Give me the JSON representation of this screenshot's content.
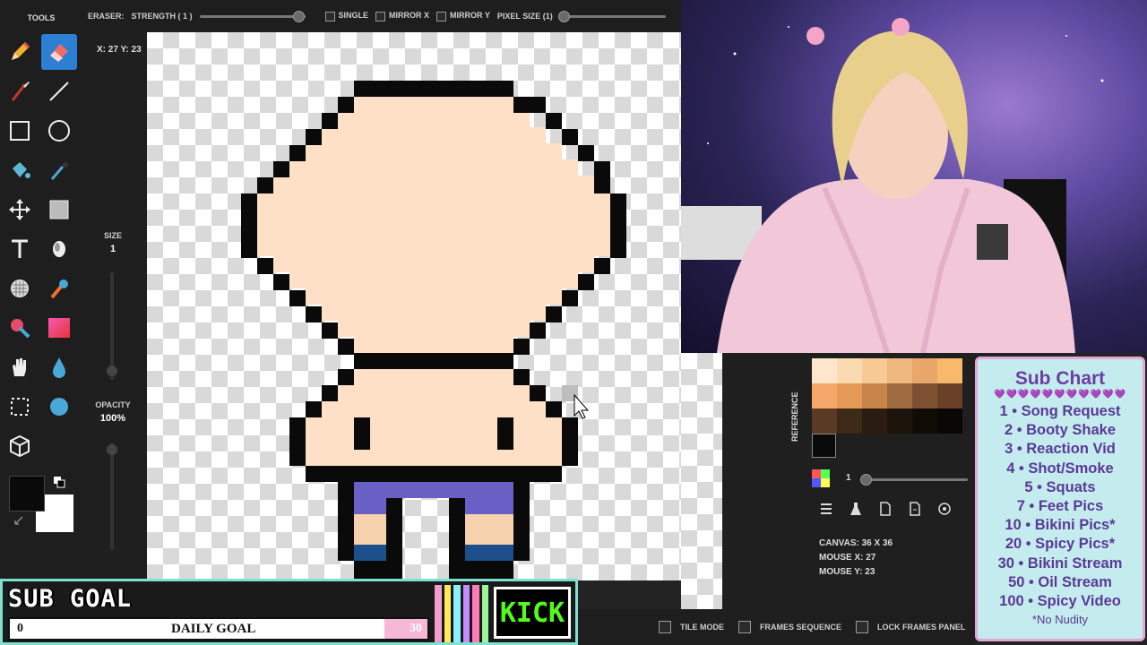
{
  "toolbar": {
    "tool_name": "ERASER:",
    "strength_label": "STRENGTH ( 1 )",
    "strength_fraction": 0.92,
    "single_label": "SINGLE",
    "mirror_x_label": "MIRROR X",
    "mirror_y_label": "MIRROR Y",
    "pixel_size_label": "PIXEL SIZE (1)",
    "pixel_size_fraction": 0.0
  },
  "tools_panel": {
    "title": "TOOLS",
    "active_tool": "eraser",
    "tools": [
      "pencil",
      "eraser",
      "brush",
      "line",
      "rectangle",
      "circle",
      "bucket",
      "eyedropper",
      "move",
      "select-rect",
      "text",
      "dodge",
      "dither",
      "stamp",
      "colorize",
      "gradient",
      "hand",
      "blur",
      "marquee",
      "smudge",
      "3d-box"
    ]
  },
  "size": {
    "label": "SIZE",
    "value": "1"
  },
  "opacity": {
    "label": "OPACITY",
    "value": "100%"
  },
  "cursor_readout": "X: 27 Y: 23",
  "info": {
    "canvas": "CANVAS: 36 X 36",
    "mouse_x": "MOUSE X: 27",
    "mouse_y": "MOUSE Y: 23"
  },
  "reference_tab": "REFERENCE",
  "palette": {
    "swatches": [
      "#fde6cb",
      "#fbd9b1",
      "#f6c995",
      "#eeb87e",
      "#e8a66b",
      "#f8b96c",
      "#f5a76a",
      "#e69a58",
      "#c98549",
      "#a06a40",
      "#7d5132",
      "#6b4028",
      "#5a3a22",
      "#3d2918",
      "#2a1c10",
      "#1d140c",
      "#120c07",
      "#0a0705"
    ],
    "current_color": "#0a0a0a",
    "opacity_value": "1"
  },
  "bottom_bar": {
    "tile_mode": "TILE MODE",
    "frames_sequence": "FRAMES SEQUENCE",
    "lock_frames_panel": "LOCK FRAMES PANEL"
  },
  "sub_chart": {
    "title": "Sub Chart",
    "hearts": "💜💜💜💜💜💜💜💜💜💜💜",
    "items": [
      "1 • Song Request",
      "2 • Booty Shake",
      "3 • Reaction Vid",
      "4 • Shot/Smoke",
      "5 • Squats",
      "7 • Feet Pics",
      "10 • Bikini Pics*",
      "20 • Spicy Pics*",
      "30 • Bikini Stream",
      "50 • Oil Stream",
      "100 • Spicy Video"
    ],
    "footer": "*No Nudity"
  },
  "sub_goal": {
    "title": "SUB GOAL",
    "current": "0",
    "label": "DAILY GOAL",
    "target": "30",
    "platform": "KICK",
    "stripe_colors": [
      "#f39bd0",
      "#ffe85c",
      "#8cf0ff",
      "#c58cff",
      "#ff7bb8",
      "#9bf59b"
    ]
  },
  "colors": {
    "skin": "#fde0c5",
    "outline": "#0a0a0a",
    "shorts": "#6a5fc4",
    "sock": "#1d4f8a",
    "sock_light": "#f6d1ae"
  }
}
